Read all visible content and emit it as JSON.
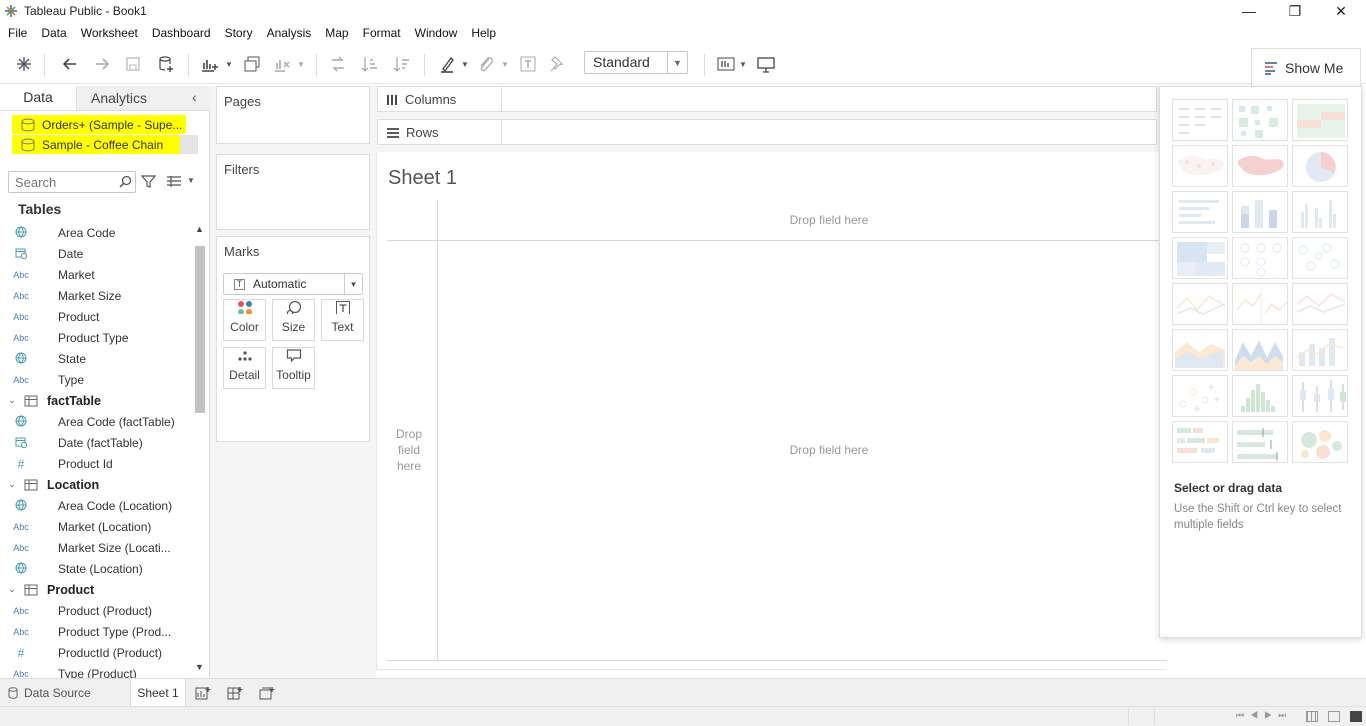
{
  "window": {
    "title": "Tableau Public - Book1",
    "minimize": "—",
    "maximize": "❐",
    "close": "✕"
  },
  "menu": [
    "File",
    "Data",
    "Worksheet",
    "Dashboard",
    "Story",
    "Analysis",
    "Map",
    "Format",
    "Window",
    "Help"
  ],
  "toolbar": {
    "view_size": "Standard"
  },
  "show_me": {
    "tab_label": "Show Me",
    "hint_title": "Select or drag data",
    "hint_text": "Use the Shift or Ctrl key to select multiple fields"
  },
  "left": {
    "tabs": [
      "Data",
      "Analytics"
    ],
    "datasources": [
      "Orders+ (Sample - Supe...",
      "Sample - Coffee Chain"
    ],
    "search_placeholder": "Search",
    "tables_heading": "Tables",
    "rows": [
      {
        "kind": "field",
        "type": "⊕",
        "name": "Area Code"
      },
      {
        "kind": "field",
        "type": "📅",
        "name": "Date"
      },
      {
        "kind": "field",
        "type": "Abc",
        "name": "Market"
      },
      {
        "kind": "field",
        "type": "Abc",
        "name": "Market Size"
      },
      {
        "kind": "field",
        "type": "Abc",
        "name": "Product"
      },
      {
        "kind": "field",
        "type": "Abc",
        "name": "Product Type"
      },
      {
        "kind": "field",
        "type": "⊕",
        "name": "State"
      },
      {
        "kind": "field",
        "type": "Abc",
        "name": "Type"
      },
      {
        "kind": "group",
        "name": "factTable"
      },
      {
        "kind": "field",
        "type": "⊕",
        "name": "Area Code (factTable)"
      },
      {
        "kind": "field",
        "type": "📅",
        "name": "Date (factTable)"
      },
      {
        "kind": "field",
        "type": "#",
        "name": "Product Id"
      },
      {
        "kind": "group",
        "name": "Location"
      },
      {
        "kind": "field",
        "type": "⊕",
        "name": "Area Code (Location)"
      },
      {
        "kind": "field",
        "type": "Abc",
        "name": "Market (Location)"
      },
      {
        "kind": "field",
        "type": "Abc",
        "name": "Market Size (Locati..."
      },
      {
        "kind": "field",
        "type": "⊕",
        "name": "State (Location)"
      },
      {
        "kind": "group",
        "name": "Product"
      },
      {
        "kind": "field",
        "type": "Abc",
        "name": "Product (Product)"
      },
      {
        "kind": "field",
        "type": "Abc",
        "name": "Product Type (Prod..."
      },
      {
        "kind": "field",
        "type": "#",
        "name": "ProductId (Product)"
      },
      {
        "kind": "field",
        "type": "Abc",
        "name": "Type (Product)"
      }
    ]
  },
  "cards": {
    "pages": "Pages",
    "filters": "Filters",
    "marks": "Marks",
    "mark_type": "Automatic",
    "mark_buttons": [
      "Color",
      "Size",
      "Text",
      "Detail",
      "Tooltip"
    ]
  },
  "shelves": {
    "columns": "Columns",
    "rows": "Rows"
  },
  "sheet": {
    "title": "Sheet 1",
    "drop_top": "Drop field here",
    "drop_main": "Drop field here",
    "drop_left": "Drop\nfield\nhere"
  },
  "tabs": {
    "data_source": "Data Source",
    "sheet1": "Sheet 1"
  }
}
